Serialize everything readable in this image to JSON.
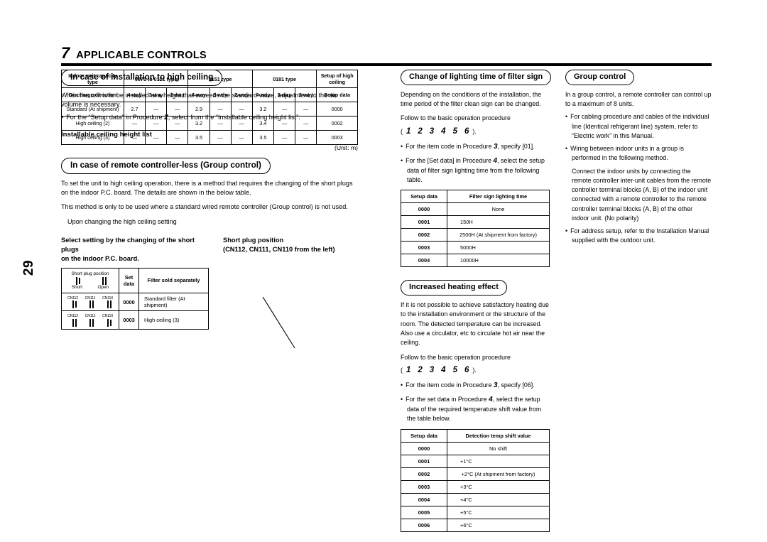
{
  "page": {
    "number": "29"
  },
  "chapter": {
    "number": "7",
    "title": "APPLICABLE CONTROLS"
  },
  "left": {
    "high_ceiling": {
      "heading": "In case of installation to high ceiling",
      "intro": "When the unit is to be installed at a height that exceeds the standard value, adjustment to the air volume is necessary.",
      "bullet_pre": "For the “Setup data” in Procedure",
      "bullet_proc": "2",
      "bullet_post": ", select from the “Installable ceiling height list”.",
      "list_title": "Installable ceiling height list",
      "unit_note": "(Unit: m)",
      "table": {
        "row1": [
          "Indoor unit capacity type",
          "0071 to 0121 type",
          "0151 type",
          "0181 type",
          "Setup of high ceiling"
        ],
        "row2": [
          "Discharge direction",
          "4-way",
          "3-way",
          "2-way",
          "4-way",
          "3-way",
          "2-way",
          "4-way",
          "3-way",
          "2-way",
          "Setup data"
        ],
        "rows": [
          [
            "Standard (At shipment)",
            "2.7",
            "—",
            "—",
            "2.9",
            "—",
            "—",
            "3.2",
            "—",
            "—",
            "0000"
          ],
          [
            "High ceiling (2)",
            "—",
            "—",
            "—",
            "3.2",
            "—",
            "—",
            "3.4",
            "—",
            "—",
            "0002"
          ],
          [
            "High ceiling (3)",
            "—",
            "—",
            "—",
            "3.5",
            "—",
            "—",
            "3.5",
            "—",
            "—",
            "0003"
          ]
        ]
      }
    },
    "group_less": {
      "heading": "In case of remote controller-less (Group control)",
      "para1": "To set the unit to high ceiling operation, there is a method that requires the changing of the short plugs on the indoor P.C. board. The details are shown in the below table.",
      "para2": "This method is only to be used where a standard wired remote controller (Group control) is not used.",
      "para3": "Upon changing the high ceiling setting",
      "select_label_1": "Select setting by the changing of the short plugs",
      "select_label_2": "on the indoor P.C. board.",
      "plug_pos_1": "Short plug position",
      "plug_pos_2": "(CN112, CN111, CN110 from the left)",
      "plug_table": {
        "legend_title": "Short plug position",
        "legend_short": "Short",
        "legend_open": "Open",
        "col_set": "Set data",
        "col_filter": "Filter sold separately",
        "pins": [
          "CN112",
          "CN111",
          "CN110"
        ],
        "rows": [
          {
            "states": [
              "short",
              "open",
              "open"
            ],
            "set": "0000",
            "text": "Standard filter (At shipment)"
          },
          {
            "states": [
              "open",
              "open",
              "short"
            ],
            "set": "0003",
            "text": "High ceiling (3)"
          }
        ]
      }
    }
  },
  "middle": {
    "filter_sign": {
      "heading": "Change of lighting time of filter sign",
      "para1": "Depending on the conditions of the installation, the time period of the filter clean sign can be changed.",
      "para2": "Follow to the basic operation procedure",
      "sequence": [
        "1",
        "2",
        "3",
        "4",
        "5",
        "6"
      ],
      "seq_open": "(",
      "seq_close": ").",
      "b1_pre": "For the item code in Procedure",
      "b1_proc": "3",
      "b1_post": ", specify [01].",
      "b2_pre": "For the [Set data] in Procedure",
      "b2_proc": "4",
      "b2_post": ", select the setup data of filter sign lighting time from the following table.",
      "table": {
        "headers": [
          "Setup data",
          "Filter sign lighting time"
        ],
        "rows": [
          [
            "0000",
            "None"
          ],
          [
            "0001",
            "150H"
          ],
          [
            "0002",
            "2500H (At shipment from factory)"
          ],
          [
            "0003",
            "5000H"
          ],
          [
            "0004",
            "10000H"
          ]
        ]
      }
    },
    "heating": {
      "heading": "Increased heating effect",
      "para1": "If it is not possible to achieve satisfactory heating due to the installation environment or the structure of the room. The detected temperature can be increased. Also use a circulator, etc to circulate hot air near the ceiling.",
      "para2": "Follow to the basic operation procedure",
      "sequence": [
        "1",
        "2",
        "3",
        "4",
        "5",
        "6"
      ],
      "seq_open": "(",
      "seq_close": ").",
      "b1_pre": "For the item code in Procedure",
      "b1_proc": "3",
      "b1_post": ", specify [06].",
      "b2_pre": "For the set data in Procedure",
      "b2_proc": "4",
      "b2_post": ", select the setup data of the required temperature shift value from the table below.",
      "table": {
        "headers": [
          "Setup data",
          "Detection temp shift value"
        ],
        "rows": [
          [
            "0000",
            "No shift"
          ],
          [
            "0001",
            "+1°C"
          ],
          [
            "0002",
            "+2°C (At shipment from factory)"
          ],
          [
            "0003",
            "+3°C"
          ],
          [
            "0004",
            "+4°C"
          ],
          [
            "0005",
            "+5°C"
          ],
          [
            "0006",
            "+6°C"
          ]
        ]
      }
    }
  },
  "right": {
    "group_control": {
      "heading": "Group control",
      "para1": "In a group control, a remote controller can control up to a maximum of 8 units.",
      "b1": "For cabling procedure and cables of the individual line (Identical refrigerant line) system, refer to “Electric work” in this Manual.",
      "b2": "Wiring between indoor units in a group is performed in the following method.",
      "b2_sub": "Connect the indoor units by connecting the remote controller inter-unit cables from the remote controller terminal blocks (A, B) of the indoor unit connected with a remote controller to the remote controller terminal blocks (A, B) of the other indoor unit. (No polarity)",
      "b3": "For address setup, refer to the Installation Manual supplied with the outdoor unit."
    }
  }
}
